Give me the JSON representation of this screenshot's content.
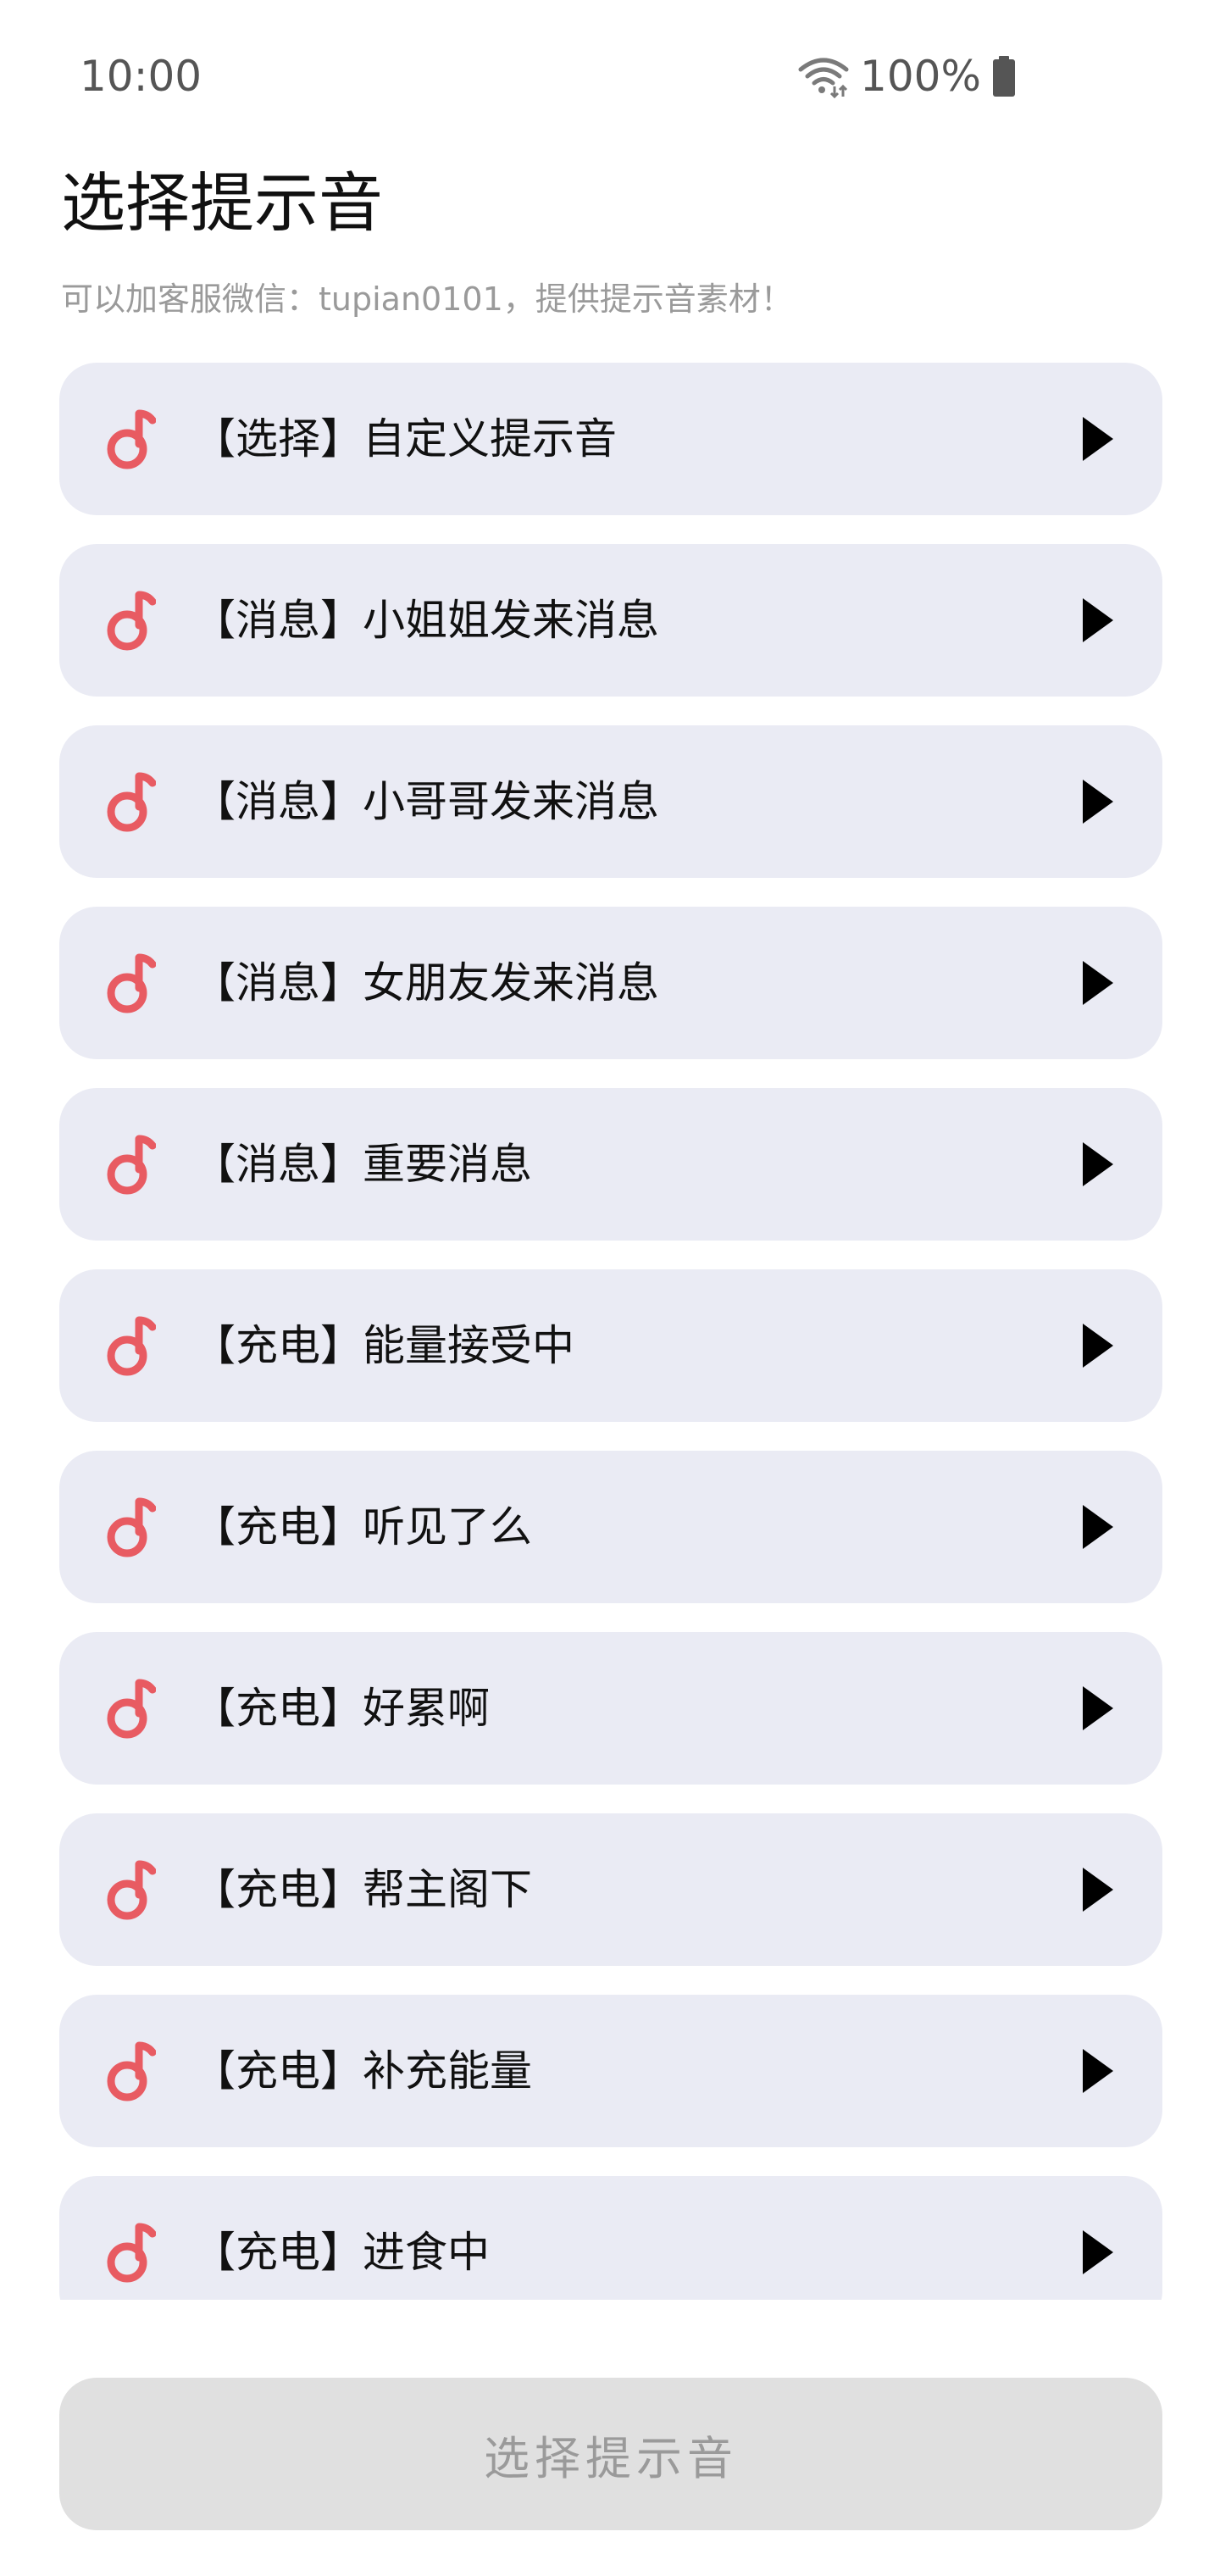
{
  "status_bar": {
    "time": "10:00",
    "battery": "100%",
    "icons": [
      "wifi-icon",
      "battery-icon"
    ]
  },
  "header": {
    "title": "选择提示音",
    "subtitle": "可以加客服微信：tupian0101，提供提示音素材！"
  },
  "sounds": {
    "items": [
      {
        "label": "【选择】自定义提示音"
      },
      {
        "label": "【消息】小姐姐发来消息"
      },
      {
        "label": "【消息】小哥哥发来消息"
      },
      {
        "label": "【消息】女朋友发来消息"
      },
      {
        "label": "【消息】重要消息"
      },
      {
        "label": "【充电】能量接受中"
      },
      {
        "label": "【充电】听见了么"
      },
      {
        "label": "【充电】好累啊"
      },
      {
        "label": "【充电】帮主阁下"
      },
      {
        "label": "【充电】补充能量"
      },
      {
        "label": "【充电】进食中"
      }
    ],
    "item_icon": "music-note-icon",
    "action_icon": "play-icon"
  },
  "footer": {
    "button_label": "选择提示音"
  },
  "colors": {
    "accent": "#e85b62",
    "card_bg": "#eaebf4",
    "button_disabled_bg": "#e0e0e0",
    "muted_text": "#9a9a9a"
  }
}
